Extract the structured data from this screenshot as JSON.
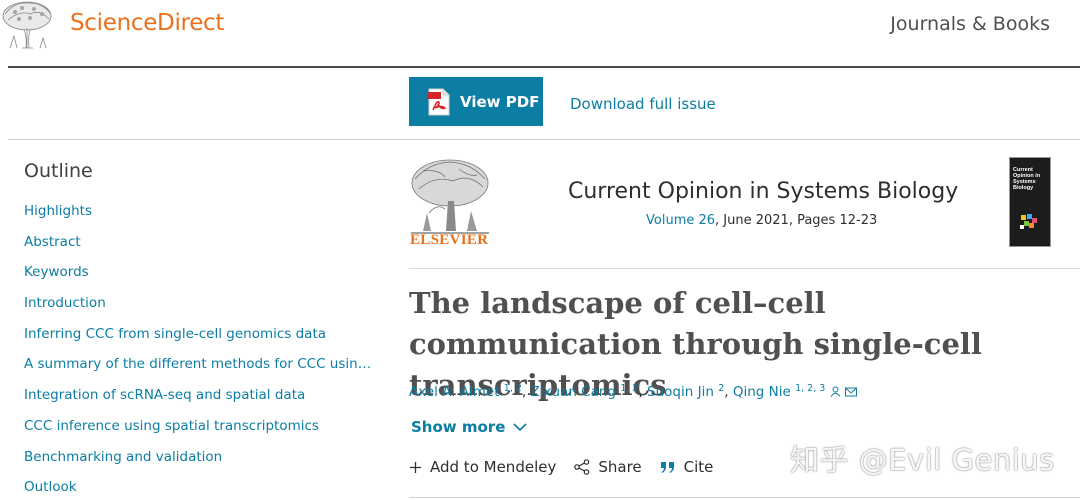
{
  "header": {
    "brand": "ScienceDirect",
    "journals_books": "Journals & Books"
  },
  "toolbar": {
    "view_pdf": "View PDF",
    "download_issue": "Download full issue"
  },
  "outline": {
    "title": "Outline",
    "items": [
      {
        "label": "Highlights"
      },
      {
        "label": "Abstract"
      },
      {
        "label": "Keywords"
      },
      {
        "label": "Introduction"
      },
      {
        "label": "Inferring CCC from single-cell genomics data"
      },
      {
        "label": "A summary of the different methods for CCC using scRNA-seq data"
      },
      {
        "label": "Integration of scRNA-seq and spatial data"
      },
      {
        "label": "CCC inference using spatial transcriptomics"
      },
      {
        "label": "Benchmarking and validation"
      },
      {
        "label": "Outlook"
      }
    ]
  },
  "journal": {
    "publisher": "ELSEVIER",
    "title": "Current Opinion in Systems Biology",
    "volume_link": "Volume 26",
    "date_pages": ", June 2021, Pages 12-23",
    "cover_title": "Current Opinion in Systems Biology"
  },
  "article": {
    "title": "The landscape of cell–cell communication through single-cell transcriptomics",
    "authors": [
      {
        "name": "Axel A. Almet",
        "sup": "1, 2"
      },
      {
        "name": "Zixuan Cang",
        "sup": "1, 2"
      },
      {
        "name": "Suoqin Jin",
        "sup": "2"
      },
      {
        "name": "Qing Nie",
        "sup": "1, 2, 3"
      }
    ],
    "author_separator": ", ",
    "show_more": "Show more"
  },
  "actions": {
    "mendeley": "Add to Mendeley",
    "share": "Share",
    "cite": "Cite"
  },
  "watermark": "知乎 @Evil Genius",
  "colors": {
    "brand_orange": "#e9711c",
    "link_blue": "#0c7da3",
    "pdf_button": "#0c7da3"
  },
  "icons": [
    "tree-logo-icon",
    "pdf-file-icon",
    "person-icon",
    "envelope-icon",
    "chevron-down-icon",
    "plus-icon",
    "share-icon",
    "quote-icon"
  ]
}
